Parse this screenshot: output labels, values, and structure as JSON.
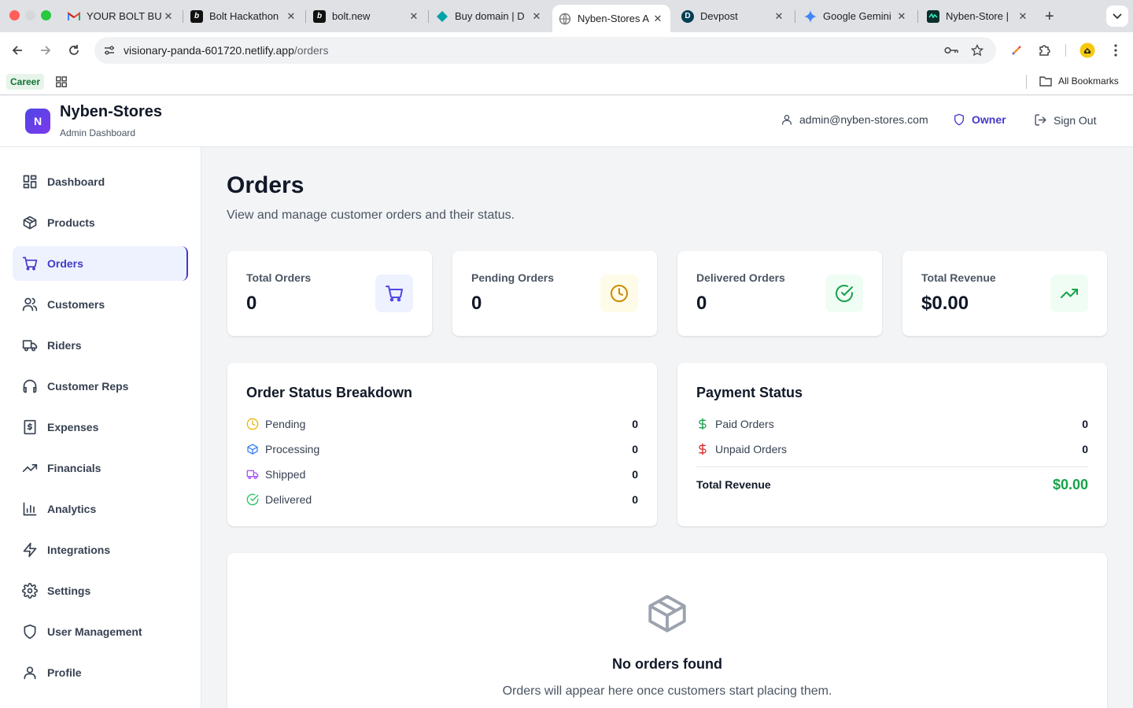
{
  "browser": {
    "tabs": [
      {
        "title": "YOUR BOLT BU",
        "favicon": "gmail-icon"
      },
      {
        "title": "Bolt Hackathon",
        "favicon": "bolt-b-icon"
      },
      {
        "title": "bolt.new",
        "favicon": "bolt-b-icon"
      },
      {
        "title": "Buy domain | D",
        "favicon": "domain-diamond-icon"
      },
      {
        "title": "Nyben-Stores A",
        "favicon": "globe-icon",
        "active": true
      },
      {
        "title": "Devpost",
        "favicon": "devpost-icon"
      },
      {
        "title": "Google Gemini",
        "favicon": "gemini-icon"
      },
      {
        "title": "Nyben-Store |",
        "favicon": "netlify-icon"
      }
    ],
    "url_host": "visionary-panda-601720.netlify.app",
    "url_path": "/orders",
    "bookmarks": {
      "career": "Career",
      "all": "All Bookmarks"
    }
  },
  "header": {
    "logo_letter": "N",
    "brand": "Nyben-Stores",
    "subtitle": "Admin Dashboard",
    "user_email": "admin@nyben-stores.com",
    "role": "Owner",
    "sign_out": "Sign Out"
  },
  "sidebar": {
    "items": [
      {
        "label": "Dashboard",
        "icon": "dashboard-icon"
      },
      {
        "label": "Products",
        "icon": "box-icon"
      },
      {
        "label": "Orders",
        "icon": "cart-icon",
        "active": true
      },
      {
        "label": "Customers",
        "icon": "users-icon"
      },
      {
        "label": "Riders",
        "icon": "truck-icon"
      },
      {
        "label": "Customer Reps",
        "icon": "headphones-icon"
      },
      {
        "label": "Expenses",
        "icon": "receipt-icon"
      },
      {
        "label": "Financials",
        "icon": "trending-up-icon"
      },
      {
        "label": "Analytics",
        "icon": "bar-chart-icon"
      },
      {
        "label": "Integrations",
        "icon": "zap-icon"
      },
      {
        "label": "Settings",
        "icon": "gear-icon"
      },
      {
        "label": "User Management",
        "icon": "shield-icon"
      },
      {
        "label": "Profile",
        "icon": "user-icon"
      }
    ]
  },
  "page": {
    "title": "Orders",
    "subtitle": "View and manage customer orders and their status."
  },
  "stats": [
    {
      "label": "Total Orders",
      "value": "0",
      "icon": "cart-icon",
      "color": "#4f46e5",
      "bg": "#eef2ff"
    },
    {
      "label": "Pending Orders",
      "value": "0",
      "icon": "clock-icon",
      "color": "#ca8a04",
      "bg": "#fefce8"
    },
    {
      "label": "Delivered Orders",
      "value": "0",
      "icon": "check-circle-icon",
      "color": "#16a34a",
      "bg": "#f0fdf4"
    },
    {
      "label": "Total Revenue",
      "value": "$0.00",
      "icon": "trending-up-icon",
      "color": "#16a34a",
      "bg": "#f0fdf4"
    }
  ],
  "order_status": {
    "title": "Order Status Breakdown",
    "rows": [
      {
        "label": "Pending",
        "value": "0",
        "icon": "clock-icon",
        "color": "#eab308"
      },
      {
        "label": "Processing",
        "value": "0",
        "icon": "box-icon",
        "color": "#3b82f6"
      },
      {
        "label": "Shipped",
        "value": "0",
        "icon": "truck-icon",
        "color": "#a855f7"
      },
      {
        "label": "Delivered",
        "value": "0",
        "icon": "check-circle-icon",
        "color": "#22c55e"
      }
    ]
  },
  "payment_status": {
    "title": "Payment Status",
    "rows": [
      {
        "label": "Paid Orders",
        "value": "0",
        "icon": "dollar-icon",
        "color": "#16a34a"
      },
      {
        "label": "Unpaid Orders",
        "value": "0",
        "icon": "dollar-icon",
        "color": "#dc2626"
      }
    ],
    "total_label": "Total Revenue",
    "total_value": "$0.00"
  },
  "empty_state": {
    "title": "No orders found",
    "message": "Orders will appear here once customers start placing them."
  },
  "colors": {
    "accent": "#4338ca",
    "accent_bg": "#eef2ff",
    "success": "#16a34a"
  }
}
